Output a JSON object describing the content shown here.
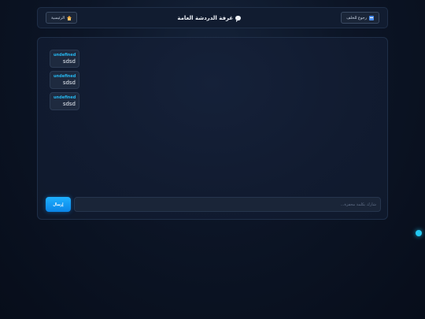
{
  "header": {
    "back_label": "رجوع للخلف",
    "back_icon": "back-arrow-icon",
    "title": "غرفة الدردشة العامة",
    "title_icon": "chat-bubble-icon",
    "home_label": "الرئيسية",
    "home_icon": "home-icon"
  },
  "messages": [
    {
      "user": "undefined",
      "text": "sdsd"
    },
    {
      "user": "undefined",
      "text": "sdsd"
    },
    {
      "user": "undefined",
      "text": "sdsd"
    }
  ],
  "composer": {
    "placeholder": "شارك بكلمة محفزة...",
    "value": "",
    "send_label": "إرسال"
  },
  "colors": {
    "accent": "#1fb0ff",
    "username": "#26b6ee",
    "background": "#0c1526"
  }
}
